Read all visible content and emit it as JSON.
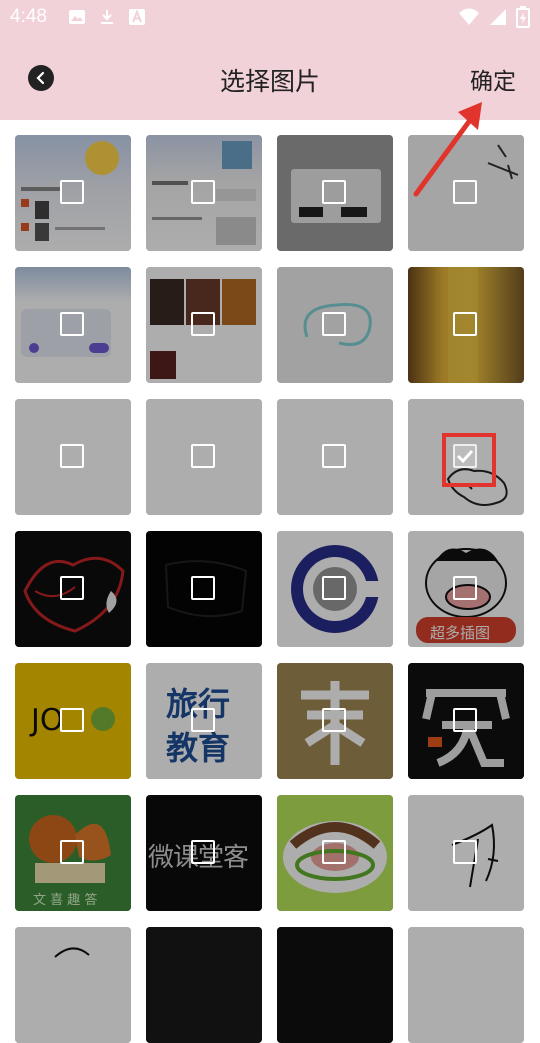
{
  "status": {
    "time": "4:48"
  },
  "header": {
    "title": "选择图片",
    "confirm_label": "确定"
  },
  "thumbs": {
    "chaoduo": "超多插图",
    "jo": "JO",
    "lvyou": "旅行",
    "jiaoyu": "教育",
    "wenke": "微课堂客",
    "wenxi": "文 喜 趣 答"
  },
  "grid": {
    "rows": 7,
    "columns": 4,
    "selected_index": 11
  }
}
